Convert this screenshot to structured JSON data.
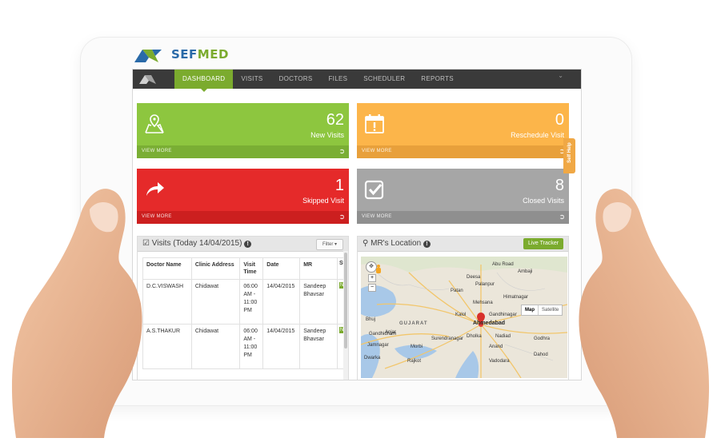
{
  "brand": {
    "name": "SEFMED",
    "name_color_1": "#2a6aa8",
    "name_color_2": "#7bab2e"
  },
  "nav": {
    "items": [
      {
        "label": "DASHBOARD",
        "active": true
      },
      {
        "label": "VISITS",
        "active": false
      },
      {
        "label": "DOCTORS",
        "active": false
      },
      {
        "label": "FILES",
        "active": false
      },
      {
        "label": "SCHEDULER",
        "active": false
      },
      {
        "label": "REPORTS",
        "active": false
      }
    ],
    "chevron": "chevron-down-icon"
  },
  "tiles": [
    {
      "count": "62",
      "label": "New Visits",
      "footer": "VIEW MORE",
      "color": "#8dc63f",
      "icon": "map-marker-icon"
    },
    {
      "count": "0",
      "label": "Reschedule Visit",
      "footer": "VIEW MORE",
      "color": "#fcb54a",
      "icon": "calendar-alert-icon"
    },
    {
      "count": "1",
      "label": "Skipped Visit",
      "footer": "VIEW MORE",
      "color": "#e52a2a",
      "icon": "share-arrow-icon"
    },
    {
      "count": "8",
      "label": "Closed Visits",
      "footer": "VIEW MORE",
      "color": "#a6a6a6",
      "icon": "checkbox-icon"
    }
  ],
  "self_help": {
    "label": "Self Help"
  },
  "visits_panel": {
    "title": "Visits (Today 14/04/2015)",
    "filter_label": "Filter",
    "columns": [
      "Doctor Name",
      "Clinic Address",
      "Visit Time",
      "Date",
      "MR",
      "St"
    ],
    "rows": [
      {
        "doctor": "D.C.VISWASH",
        "clinic": "Chidawat",
        "time": "06:00 AM - 11:00 PM",
        "date": "14/04/2015",
        "mr": "Sandeep Bhavsar",
        "status": "N"
      },
      {
        "doctor": "A.S.THAKUR",
        "clinic": "Chidawat",
        "time": "06:00 AM - 11:00 PM",
        "date": "14/04/2015",
        "mr": "Sandeep Bhavsar",
        "status": "N"
      }
    ]
  },
  "location_panel": {
    "title": "MR's Location",
    "live_tracker_label": "Live Tracker",
    "map_button": "Map",
    "satellite_button": "Satellite",
    "places": [
      "Abu Road",
      "Ambaji",
      "Palanpur",
      "Deesa",
      "Patan",
      "Mehsana",
      "Himatnagar",
      "Bhuj",
      "GUJARAT",
      "Ahmedabad",
      "Gandhinagar",
      "Jamnagar",
      "Surendranagar",
      "Dholka",
      "Nadiad",
      "Anand",
      "Morbi",
      "Rajkot",
      "Vadodara",
      "Godhra",
      "Dahod",
      "Anjar",
      "Gandhidham",
      "Dwarka",
      "Kalol"
    ]
  },
  "colors": {
    "accent": "#7bab2e",
    "nav_bg": "#3a3a3a"
  }
}
